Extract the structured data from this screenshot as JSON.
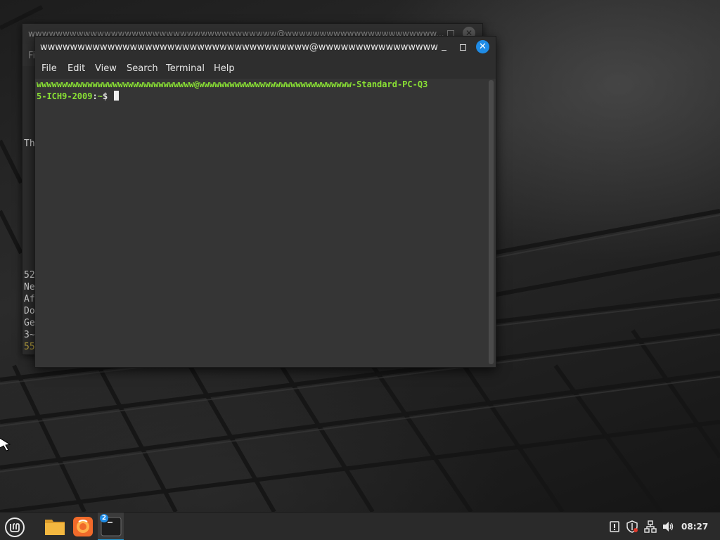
{
  "background_window": {
    "title": "wwwwwwwwwwwwwwwwwwwwwwwwwwwwwwwwwwww@wwwwwwwwwwwwwwwwwwwwww...",
    "menu_first": "Fi",
    "lines": [
      "Th",
      "52",
      "Ne",
      "Af",
      "Do",
      "Ge",
      "3~",
      "55"
    ]
  },
  "terminal": {
    "title": "wwwwwwwwwwwwwwwwwwwwwwwwwwwwwwwwwwww@wwwwwwwwwwwwwwwwwwwwww...",
    "minimize_label": "",
    "maximize_label": "",
    "close_label": "✕",
    "menu": [
      "File",
      "Edit",
      "View",
      "Search",
      "Terminal",
      "Help"
    ],
    "prompt_line1": "wwwwwwwwwwwwwwwwwwwwwwwwwwwwwww@wwwwwwwwwwwwwwwwwwwwwwwwwwwwww-Standard-PC-Q3",
    "prompt_line2_host": "5-ICH9-2009",
    "prompt_sep": ":",
    "prompt_path": "~",
    "prompt_symbol": "$ "
  },
  "taskbar": {
    "apps": [
      {
        "name": "menu-icon"
      },
      {
        "name": "files-icon"
      },
      {
        "name": "firefox-icon"
      },
      {
        "name": "terminal-icon",
        "badge": "2"
      }
    ],
    "tray": [
      "update-manager-icon",
      "shield-icon",
      "network-icon",
      "volume-icon"
    ],
    "clock": "08:27"
  },
  "colors": {
    "accent": "#1f8ce6",
    "prompt_green": "#8ae234"
  }
}
